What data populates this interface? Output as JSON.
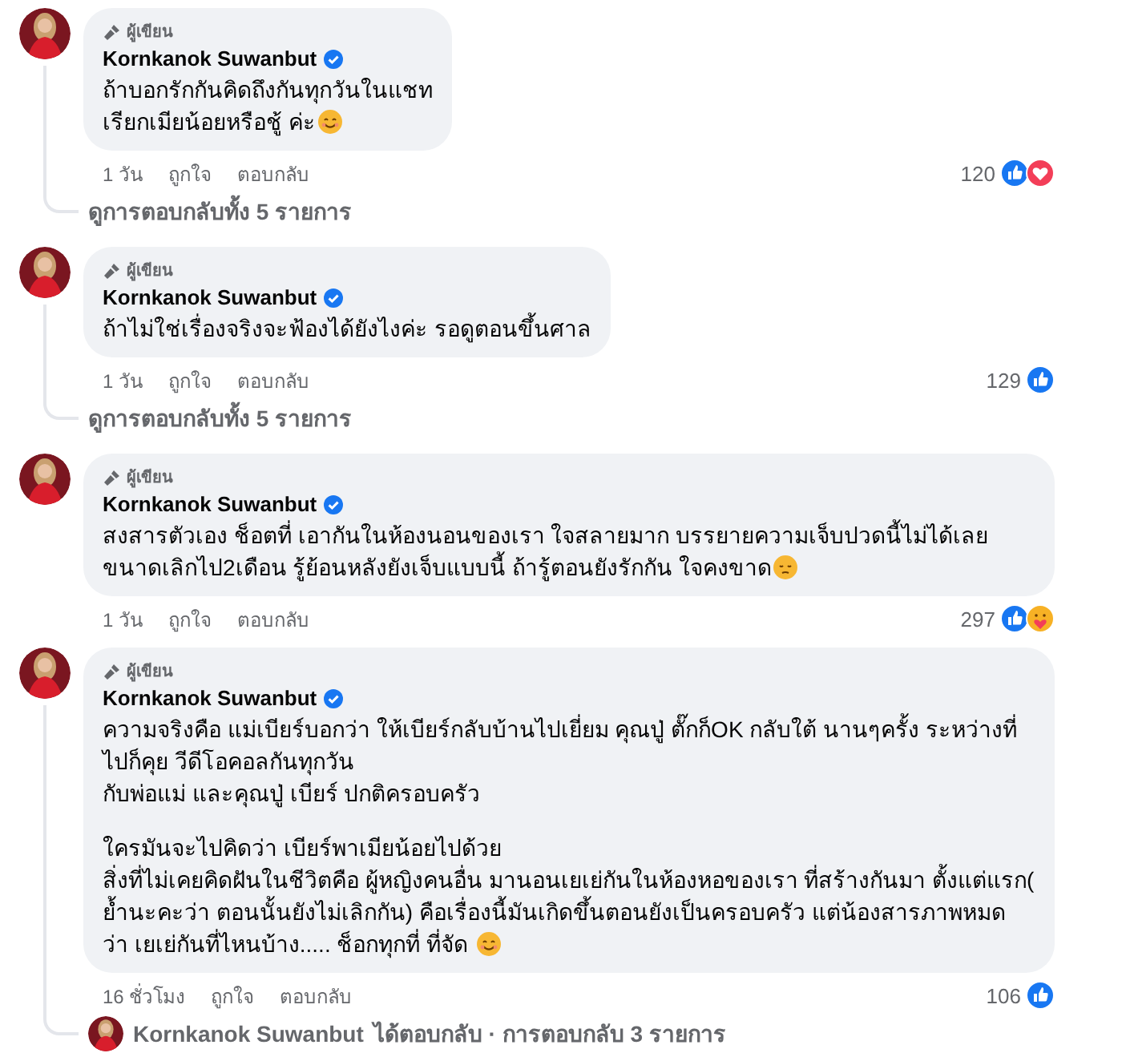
{
  "comments": [
    {
      "badge": "ผู้เขียน",
      "author": "Kornkanok Suwanbut",
      "verified": true,
      "paragraphs": [
        "ถ้าบอกรักกันคิดถึงกันทุกวันในแชท\nเรียกเมียน้อยหรือชู้ ค่ะ"
      ],
      "emoji": {
        "kind": "smile"
      },
      "time": "1 วัน",
      "like": "ถูกใจ",
      "reply": "ตอบกลับ",
      "count": "120",
      "reactions": [
        {
          "kind": "like"
        },
        {
          "kind": "love"
        }
      ],
      "replies": {
        "kind": "link",
        "text": "ดูการตอบกลับทั้ง 5 รายการ"
      }
    },
    {
      "badge": "ผู้เขียน",
      "author": "Kornkanok Suwanbut",
      "verified": true,
      "paragraphs": [
        "ถ้าไม่ใช่เรื่องจริงจะฟ้องได้ยังไงค่ะ รอดูตอนขึ้นศาล"
      ],
      "time": "1 วัน",
      "like": "ถูกใจ",
      "reply": "ตอบกลับ",
      "count": "129",
      "reactions": [
        {
          "kind": "like"
        }
      ],
      "replies": {
        "kind": "link",
        "text": "ดูการตอบกลับทั้ง 5 รายการ"
      }
    },
    {
      "badge": "ผู้เขียน",
      "author": "Kornkanok Suwanbut",
      "verified": true,
      "paragraphs": [
        "สงสารตัวเอง ช็อตที่ เอากันในห้องนอนของเรา ใจสลายมาก บรรยายความเจ็บปวดนี้ไม่ได้เลย ขนาดเลิกไป2เดือน รู้ย้อนหลังยังเจ็บแบบนี้ ถ้ารู้ตอนยังรักกัน ใจคงขาด"
      ],
      "emoji": {
        "kind": "sad"
      },
      "time": "1 วัน",
      "like": "ถูกใจ",
      "reply": "ตอบกลับ",
      "count": "297",
      "reactions": [
        {
          "kind": "like"
        },
        {
          "kind": "care"
        }
      ]
    },
    {
      "badge": "ผู้เขียน",
      "author": "Kornkanok Suwanbut",
      "verified": true,
      "paragraphs": [
        "ความจริงคือ แม่เบียร์บอกว่า ให้เบียร์กลับบ้านไปเยี่ยม คุณปู่ ตั๊กก็OK กลับใต้ นานๆครั้ง ระหว่างที่ไปก็คุย วีดีโอคอลกันทุกวัน\nกับพ่อแม่ และคุณปู่ เบียร์ ปกติครอบครัว",
        "ใครมันจะไปคิดว่า เบียร์พาเมียน้อยไปด้วย\nสิ่งที่ไม่เคยคิดฝันในชีวิตคือ ผู้หญิงคนอื่น มานอนเยเย่กันในห้องหอของเรา ที่สร้างกันมา ตั้งแต่แรก( ย้ำนะคะว่า ตอนนั้นยังไม่เลิกกัน) คือเรื่องนี้มันเกิดขึ้นตอนยังเป็นครอบครัว แต่น้องสารภาพหมด ว่า เยเย่กันที่ไหนบ้าง..... ช็อกทุกที่ ที่จัด "
      ],
      "emoji": {
        "kind": "smile"
      },
      "time": "16 ชั่วโมง",
      "like": "ถูกใจ",
      "reply": "ตอบกลับ",
      "count": "106",
      "reactions": [
        {
          "kind": "like"
        }
      ],
      "replies": {
        "kind": "summary",
        "author": "Kornkanok Suwanbut",
        "text": "ได้ตอบกลับ · การตอบกลับ 3 รายการ"
      }
    }
  ]
}
